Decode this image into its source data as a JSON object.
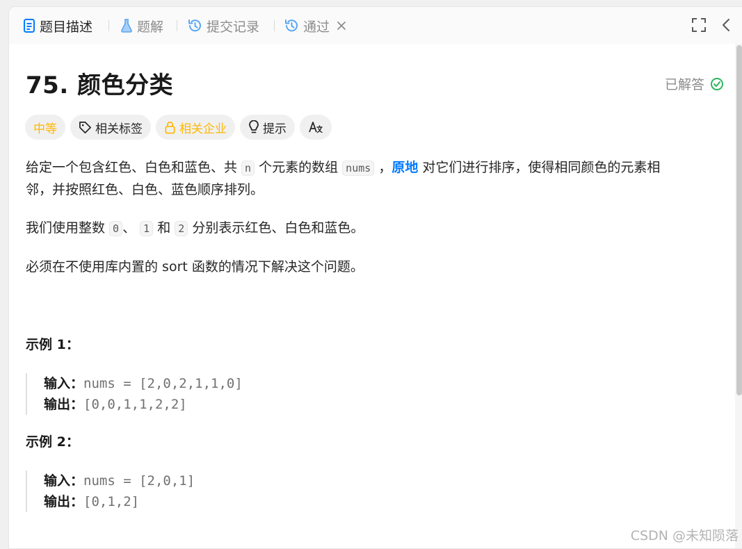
{
  "tabs": [
    {
      "label": "题目描述",
      "icon": "document-icon",
      "active": true
    },
    {
      "label": "题解",
      "icon": "flask-icon",
      "active": false
    },
    {
      "label": "提交记录",
      "icon": "history-icon",
      "active": false
    },
    {
      "label": "通过",
      "icon": "history-icon",
      "active": false
    }
  ],
  "problem": {
    "title": "75. 颜色分类",
    "status": "已解答",
    "status_color": "#2db55d"
  },
  "tags": [
    {
      "label": "中等",
      "color": "#ffb800"
    },
    {
      "label": "相关标签",
      "icon": "tag-icon"
    },
    {
      "label": "相关企业",
      "icon": "lock-icon",
      "color": "#ffb800"
    },
    {
      "label": "提示",
      "icon": "bulb-icon"
    },
    {
      "label": "Aあ",
      "icon": "translate-icon"
    }
  ],
  "description": {
    "p1_a": "给定一个包含红色、白色和蓝色、共 ",
    "p1_code1": "n",
    "p1_b": " 个元素的数组 ",
    "p1_code2": "nums",
    "p1_c": " ，",
    "p1_bold": "原地",
    "p1_d": " 对它们进行排序，使得相同颜色的元素相",
    "p1_line2": "邻，并按照红色、白色、蓝色顺序排列。",
    "p2_a": "我们使用整数 ",
    "p2_c0": "0",
    "p2_b": "、 ",
    "p2_c1": "1",
    "p2_c": " 和 ",
    "p2_c2": "2",
    "p2_d": " 分别表示红色、白色和蓝色。",
    "p3": "必须在不使用库内置的 sort 函数的情况下解决这个问题。"
  },
  "examples": [
    {
      "title": "示例 1：",
      "input_label": "输入：",
      "input": "nums = [2,0,2,1,1,0]",
      "output_label": "输出：",
      "output": "[0,0,1,1,2,2]"
    },
    {
      "title": "示例 2：",
      "input_label": "输入：",
      "input": "nums = [2,0,1]",
      "output_label": "输出：",
      "output": "[0,1,2]"
    }
  ],
  "watermark": "CSDN @未知陨落",
  "accent": "#007aff"
}
